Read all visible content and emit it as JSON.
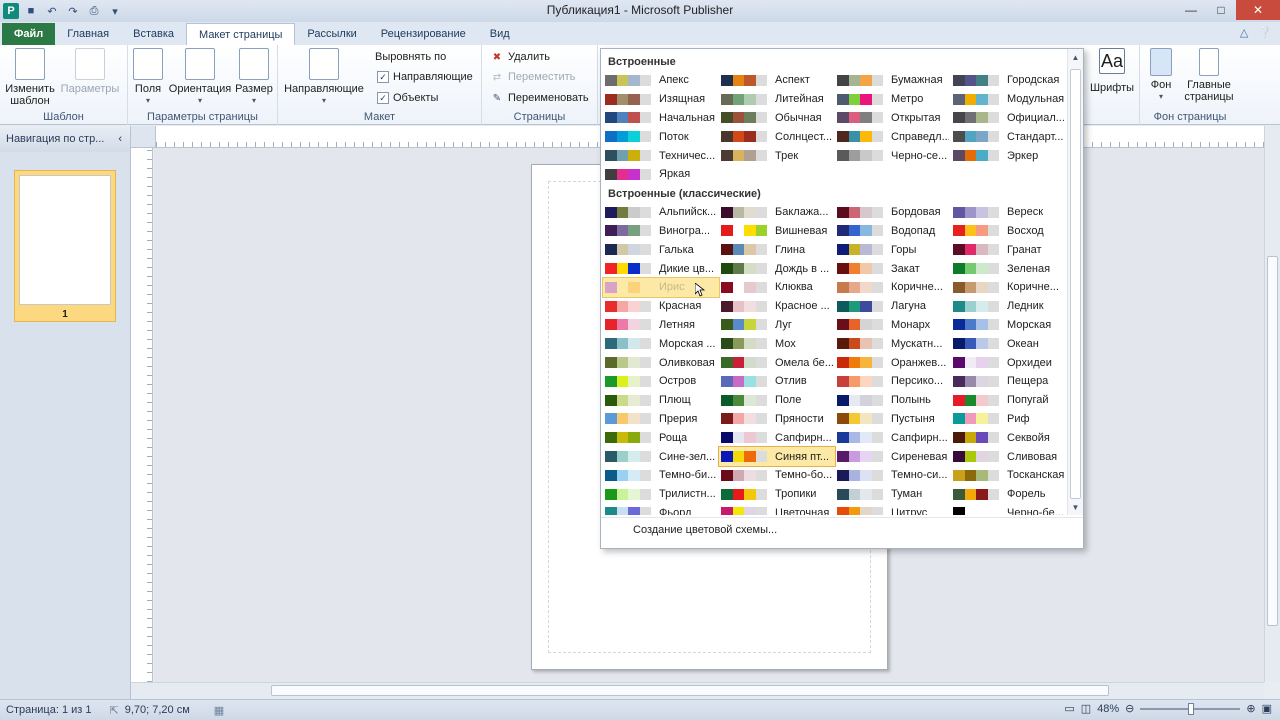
{
  "window": {
    "title": "Публикация1 - Microsoft Publisher",
    "app_logo": "P",
    "controls": [
      "minimize-icon",
      "maximize-icon",
      "close-icon"
    ]
  },
  "tabs": {
    "file": "Файл",
    "home": "Главная",
    "insert": "Вставка",
    "page_layout": "Макет страницы",
    "mailings": "Рассылки",
    "review": "Рецензирование",
    "view": "Вид"
  },
  "ribbon": {
    "template": {
      "change_template": "Изменить шаблон",
      "options": "Параметры",
      "group": "Шаблон"
    },
    "page_setup": {
      "margins": "Поля",
      "orientation": "Ориентация",
      "size": "Размер",
      "group": "Параметры страницы"
    },
    "layout": {
      "guides": "Направляющие",
      "align_to": "Выровнять по",
      "guides_check": "Направляющие",
      "objects_check": "Объекты",
      "group": "Макет"
    },
    "pages": {
      "delete": "Удалить",
      "move": "Переместить",
      "rename": "Переименовать",
      "group": "Страницы"
    },
    "right": {
      "fonts": "Шрифты",
      "background": "Фон",
      "master_pages": "Главные страницы",
      "group": "Фон страницы",
      "fonts_glyph": "Aa"
    }
  },
  "nav": {
    "title": "Навигация по стр...",
    "collapse": "‹",
    "page_number": "1"
  },
  "status": {
    "page": "Страница: 1 из 1",
    "coords": "9,70; 7,20 см",
    "zoom": "48%"
  },
  "gallery": {
    "builtin_title": "Встроенные",
    "classic_title": "Встроенные (классические)",
    "footer": "Создание цветовой схемы...",
    "builtin": [
      {
        "name": "Апекс",
        "colors": [
          "#6d6d6d",
          "#c9c45a",
          "#a3b8cf",
          "#dcdcdc"
        ]
      },
      {
        "name": "Аспект",
        "colors": [
          "#1f2f4f",
          "#e48312",
          "#bd582c",
          "#dcdcdc"
        ]
      },
      {
        "name": "Бумажная",
        "colors": [
          "#444",
          "#a5b592",
          "#f3a447",
          "#dcdcdc"
        ]
      },
      {
        "name": "Городская",
        "colors": [
          "#424456",
          "#53548a",
          "#438086",
          "#dcdcdc"
        ]
      },
      {
        "name": "Изящная",
        "colors": [
          "#9b2d1f",
          "#a28e6a",
          "#956251",
          "#dcdcdc"
        ]
      },
      {
        "name": "Литейная",
        "colors": [
          "#676a55",
          "#72a376",
          "#b0ccb0",
          "#dcdcdc"
        ]
      },
      {
        "name": "Метро",
        "colors": [
          "#4e5b6f",
          "#7fd13b",
          "#ea157a",
          "#dcdcdc"
        ]
      },
      {
        "name": "Модульная",
        "colors": [
          "#5a6378",
          "#f0ad00",
          "#60b5cc",
          "#dcdcdc"
        ]
      },
      {
        "name": "Начальная",
        "colors": [
          "#1f497d",
          "#4f81bd",
          "#c0504d",
          "#dcdcdc"
        ]
      },
      {
        "name": "Обычная",
        "colors": [
          "#444d26",
          "#9c5238",
          "#6d7e5c",
          "#dcdcdc"
        ]
      },
      {
        "name": "Открытая",
        "colors": [
          "#5b4b66",
          "#db5e7e",
          "#7f7f7f",
          "#dcdcdc"
        ]
      },
      {
        "name": "Официал...",
        "colors": [
          "#46464a",
          "#6f6f74",
          "#a7b789",
          "#dcdcdc"
        ]
      },
      {
        "name": "Поток",
        "colors": [
          "#0f6fc6",
          "#009dd9",
          "#0bd0d9",
          "#dcdcdc"
        ]
      },
      {
        "name": "Солнцест...",
        "colors": [
          "#49372b",
          "#d34817",
          "#9b2d1f",
          "#dcdcdc"
        ]
      },
      {
        "name": "Справедл...",
        "colors": [
          "#4f271c",
          "#3891a7",
          "#feb80a",
          "#dcdcdc"
        ]
      },
      {
        "name": "Стандарт...",
        "colors": [
          "#4d4d4d",
          "#50a6c2",
          "#7ba6c7",
          "#dcdcdc"
        ]
      },
      {
        "name": "Техничес...",
        "colors": [
          "#2f4f5f",
          "#6ea0b0",
          "#ccaf0a",
          "#dcdcdc"
        ]
      },
      {
        "name": "Трек",
        "colors": [
          "#4b3b34",
          "#d8b25c",
          "#b0a094",
          "#dcdcdc"
        ]
      },
      {
        "name": "Черно-се...",
        "colors": [
          "#5a5a5a",
          "#9d9d9d",
          "#c9c9c9",
          "#dcdcdc"
        ]
      },
      {
        "name": "Эркер",
        "colors": [
          "#5c4a64",
          "#e36c09",
          "#4bacc6",
          "#dcdcdc"
        ]
      },
      {
        "name": "Яркая",
        "colors": [
          "#3f3f3f",
          "#e32d91",
          "#c830cc",
          "#dcdcdc"
        ]
      }
    ],
    "classic": [
      {
        "name": "Альпийск...",
        "colors": [
          "#1f1a5c",
          "#737b3e",
          "#cbcbcb",
          "#dcdcdc"
        ]
      },
      {
        "name": "Баклажа...",
        "colors": [
          "#3a0b2b",
          "#b8b8a5",
          "#e2dbcf",
          "#dcdcdc"
        ]
      },
      {
        "name": "Бордовая",
        "colors": [
          "#5b0c1e",
          "#cc6677",
          "#d6c8cc",
          "#dcdcdc"
        ]
      },
      {
        "name": "Вереск",
        "colors": [
          "#6455a3",
          "#9b95c9",
          "#c7c3e0",
          "#dcdcdc"
        ]
      },
      {
        "name": "Виногра...",
        "colors": [
          "#3d1e57",
          "#7d6b9f",
          "#78a07f",
          "#dcdcdc"
        ]
      },
      {
        "name": "Вишневая",
        "colors": [
          "#e51a1a",
          "#ffffff",
          "#ffdd00",
          "#9bd12b"
        ]
      },
      {
        "name": "Водопад",
        "colors": [
          "#1f2a78",
          "#3366cc",
          "#87b8e0",
          "#dcdcdc"
        ]
      },
      {
        "name": "Восход",
        "colors": [
          "#e6211e",
          "#fec01b",
          "#f79a82",
          "#dcdcdc"
        ]
      },
      {
        "name": "Галька",
        "colors": [
          "#1a2a52",
          "#d0c8a8",
          "#cfd6e0",
          "#dcdcdc"
        ]
      },
      {
        "name": "Глина",
        "colors": [
          "#5a1111",
          "#5b8ab9",
          "#dcc7a7",
          "#dcdcdc"
        ]
      },
      {
        "name": "Горы",
        "colors": [
          "#0f1c78",
          "#c9b22a",
          "#b9b9d5",
          "#dcdcdc"
        ]
      },
      {
        "name": "Гранат",
        "colors": [
          "#5a0d25",
          "#e12a6a",
          "#d8b9c1",
          "#dcdcdc"
        ]
      },
      {
        "name": "Дикие цв...",
        "colors": [
          "#f02424",
          "#ffd900",
          "#0a2cc9",
          "#dcdcdc"
        ]
      },
      {
        "name": "Дождь в ...",
        "colors": [
          "#1f4a0c",
          "#607a4a",
          "#d3dec5",
          "#dcdcdc"
        ]
      },
      {
        "name": "Закат",
        "colors": [
          "#6a0f0f",
          "#f08030",
          "#f0c9a8",
          "#dcdcdc"
        ]
      },
      {
        "name": "Зеленая",
        "colors": [
          "#0f7a2a",
          "#75c970",
          "#cce9c9",
          "#dcdcdc"
        ]
      },
      {
        "name": "Ирис",
        "colors": [
          "#d9a3c7",
          "#fdeaa6",
          "#fcd27c",
          "#fde9a6"
        ]
      },
      {
        "name": "Клюква",
        "colors": [
          "#8a0a1f",
          "#ffffff",
          "#e7c8ce",
          "#dcdcdc"
        ]
      },
      {
        "name": "Коричне...",
        "colors": [
          "#c97a4a",
          "#e6a78a",
          "#f2d8c8",
          "#dcdcdc"
        ]
      },
      {
        "name": "Коричне...",
        "colors": [
          "#8a5a2a",
          "#c69b6d",
          "#e8d6c2",
          "#dcdcdc"
        ]
      },
      {
        "name": "Красная",
        "colors": [
          "#e82d2d",
          "#f7a6a6",
          "#fbd2d2",
          "#dcdcdc"
        ]
      },
      {
        "name": "Красное ...",
        "colors": [
          "#4a1a2a",
          "#e6c1c8",
          "#f2dde1",
          "#dcdcdc"
        ]
      },
      {
        "name": "Лагуна",
        "colors": [
          "#0f5a5a",
          "#1e9a7a",
          "#3c4ba0",
          "#dcdcdc"
        ]
      },
      {
        "name": "Ледник",
        "colors": [
          "#1e8a8a",
          "#9bd0d0",
          "#d6ecec",
          "#dcdcdc"
        ]
      },
      {
        "name": "Летняя",
        "colors": [
          "#e8242b",
          "#ec79a8",
          "#f2d3e0",
          "#dcdcdc"
        ]
      },
      {
        "name": "Луг",
        "colors": [
          "#3a5a1a",
          "#5a8ac9",
          "#c6d53a",
          "#dcdcdc"
        ]
      },
      {
        "name": "Монарх",
        "colors": [
          "#6a0f1a",
          "#e8632a",
          "#d4d4d4",
          "#dcdcdc"
        ]
      },
      {
        "name": "Морская",
        "colors": [
          "#0a2a9a",
          "#4a7ac9",
          "#a5c1e8",
          "#dcdcdc"
        ]
      },
      {
        "name": "Морская ...",
        "colors": [
          "#2a6a7a",
          "#8ac0c9",
          "#d2e8ec",
          "#dcdcdc"
        ]
      },
      {
        "name": "Мох",
        "colors": [
          "#2a4a1a",
          "#8a9a5a",
          "#d5dcc6",
          "#dcdcdc"
        ]
      },
      {
        "name": "Мускатн...",
        "colors": [
          "#5a1a0a",
          "#c94a1a",
          "#e8c2b3",
          "#dcdcdc"
        ]
      },
      {
        "name": "Океан",
        "colors": [
          "#0a1a6a",
          "#3a5ab9",
          "#b9c9e8",
          "#dcdcdc"
        ]
      },
      {
        "name": "Оливковая",
        "colors": [
          "#5a6a2a",
          "#b9c98a",
          "#e2e8d2",
          "#dcdcdc"
        ]
      },
      {
        "name": "Омела бе...",
        "colors": [
          "#3a6a2a",
          "#c9203a",
          "#d2dccc",
          "#dcdcdc"
        ]
      },
      {
        "name": "Оранжев...",
        "colors": [
          "#c92a0a",
          "#f07a0a",
          "#f6b53a",
          "#dcdcdc"
        ]
      },
      {
        "name": "Орхидеи",
        "colors": [
          "#5a0a6a",
          "#f2eaf6",
          "#e6d2ec",
          "#dcdcdc"
        ]
      },
      {
        "name": "Остров",
        "colors": [
          "#1a9a2a",
          "#d9f21a",
          "#e8f2c9",
          "#dcdcdc"
        ]
      },
      {
        "name": "Отлив",
        "colors": [
          "#5a6ab9",
          "#c96ac9",
          "#9ae0e0",
          "#dcdcdc"
        ]
      },
      {
        "name": "Персико...",
        "colors": [
          "#c9403a",
          "#f79a6a",
          "#fcd6c1",
          "#dcdcdc"
        ]
      },
      {
        "name": "Пещера",
        "colors": [
          "#4a2a5a",
          "#9a8aa9",
          "#dcd5e2",
          "#dcdcdc"
        ]
      },
      {
        "name": "Плющ",
        "colors": [
          "#2a5a0a",
          "#cbd98a",
          "#e6ecd2",
          "#dcdcdc"
        ]
      },
      {
        "name": "Поле",
        "colors": [
          "#0a5a2a",
          "#4a8a3a",
          "#dce8d5",
          "#dcdcdc"
        ]
      },
      {
        "name": "Полынь",
        "colors": [
          "#0a1a6a",
          "#e8e8f2",
          "#d2d2dc",
          "#dcdcdc"
        ]
      },
      {
        "name": "Попугай",
        "colors": [
          "#e81a2a",
          "#1a8a2a",
          "#f2c9cc",
          "#dcdcdc"
        ]
      },
      {
        "name": "Прерия",
        "colors": [
          "#5a9ad9",
          "#f7c96a",
          "#f2e2c9",
          "#dcdcdc"
        ]
      },
      {
        "name": "Пряности",
        "colors": [
          "#7a1a1a",
          "#f2a6a6",
          "#f2dede",
          "#dcdcdc"
        ]
      },
      {
        "name": "Пустыня",
        "colors": [
          "#8a4a0a",
          "#f2c930",
          "#f2e6c2",
          "#dcdcdc"
        ]
      },
      {
        "name": "Риф",
        "colors": [
          "#0a9a9a",
          "#f09ab9",
          "#f6f29a",
          "#dcdcdc"
        ]
      },
      {
        "name": "Роща",
        "colors": [
          "#3a6a0a",
          "#c9b90a",
          "#8aa90a",
          "#dcdcdc"
        ]
      },
      {
        "name": "Сапфирн...",
        "colors": [
          "#0a0a6a",
          "#e6e6f2",
          "#ecc9d2",
          "#dcdcdc"
        ]
      },
      {
        "name": "Сапфирн...",
        "colors": [
          "#1a3a9a",
          "#a9b9e6",
          "#e2e8f6",
          "#dcdcdc"
        ]
      },
      {
        "name": "Секвойя",
        "colors": [
          "#4a1a0a",
          "#c9a90a",
          "#6a4ab9",
          "#dcdcdc"
        ]
      },
      {
        "name": "Сине-зел...",
        "colors": [
          "#2a5a6a",
          "#9ad0c9",
          "#d5ecec",
          "#dcdcdc"
        ]
      },
      {
        "name": "Синяя пт...",
        "colors": [
          "#0a1ab9",
          "#f2d90a",
          "#f06a0a",
          "#dcdcdc"
        ]
      },
      {
        "name": "Сиреневая",
        "colors": [
          "#5a1a6a",
          "#c99ae0",
          "#e6d5f2",
          "#dcdcdc"
        ]
      },
      {
        "name": "Сливовая",
        "colors": [
          "#3a0a3a",
          "#a9c90a",
          "#e2d5e2",
          "#dcdcdc"
        ]
      },
      {
        "name": "Темно-би...",
        "colors": [
          "#0a5a8a",
          "#9ad0f2",
          "#d5ecf6",
          "#dcdcdc"
        ]
      },
      {
        "name": "Темно-бо...",
        "colors": [
          "#6a0a1a",
          "#d0a9b3",
          "#ecdde2",
          "#dcdcdc"
        ]
      },
      {
        "name": "Темно-си...",
        "colors": [
          "#1a1a5a",
          "#a9b3e0",
          "#dde2f2",
          "#dcdcdc"
        ]
      },
      {
        "name": "Тосканская",
        "colors": [
          "#c9a01a",
          "#8a6a0a",
          "#a9b97a",
          "#dcdcdc"
        ]
      },
      {
        "name": "Трилистн...",
        "colors": [
          "#1a9a1a",
          "#c9f29a",
          "#e6f6d5",
          "#dcdcdc"
        ]
      },
      {
        "name": "Тропики",
        "colors": [
          "#0a6a3a",
          "#e81a1a",
          "#f2c90a",
          "#dcdcdc"
        ]
      },
      {
        "name": "Туман",
        "colors": [
          "#2a4a5a",
          "#c2d0d5",
          "#e2e8ec",
          "#dcdcdc"
        ]
      },
      {
        "name": "Форель",
        "colors": [
          "#3a5a3a",
          "#f2a90a",
          "#8a1a1a",
          "#dcdcdc"
        ]
      },
      {
        "name": "Фьорд",
        "colors": [
          "#1a8a8a",
          "#c9e0f2",
          "#6a6ad9",
          "#dcdcdc"
        ]
      },
      {
        "name": "Цветочная",
        "colors": [
          "#c91a6a",
          "#f2e90a",
          "#e0d5e6",
          "#dcdcdc"
        ]
      },
      {
        "name": "Цитрус",
        "colors": [
          "#e84a0a",
          "#f29a0a",
          "#e2d5c9",
          "#dcdcdc"
        ]
      },
      {
        "name": "Черно-бе...",
        "colors": [
          "#000000",
          "#ffffff",
          "#ffffff",
          "#ffffff"
        ]
      }
    ],
    "hover_index": 16,
    "selected_index": 53
  }
}
